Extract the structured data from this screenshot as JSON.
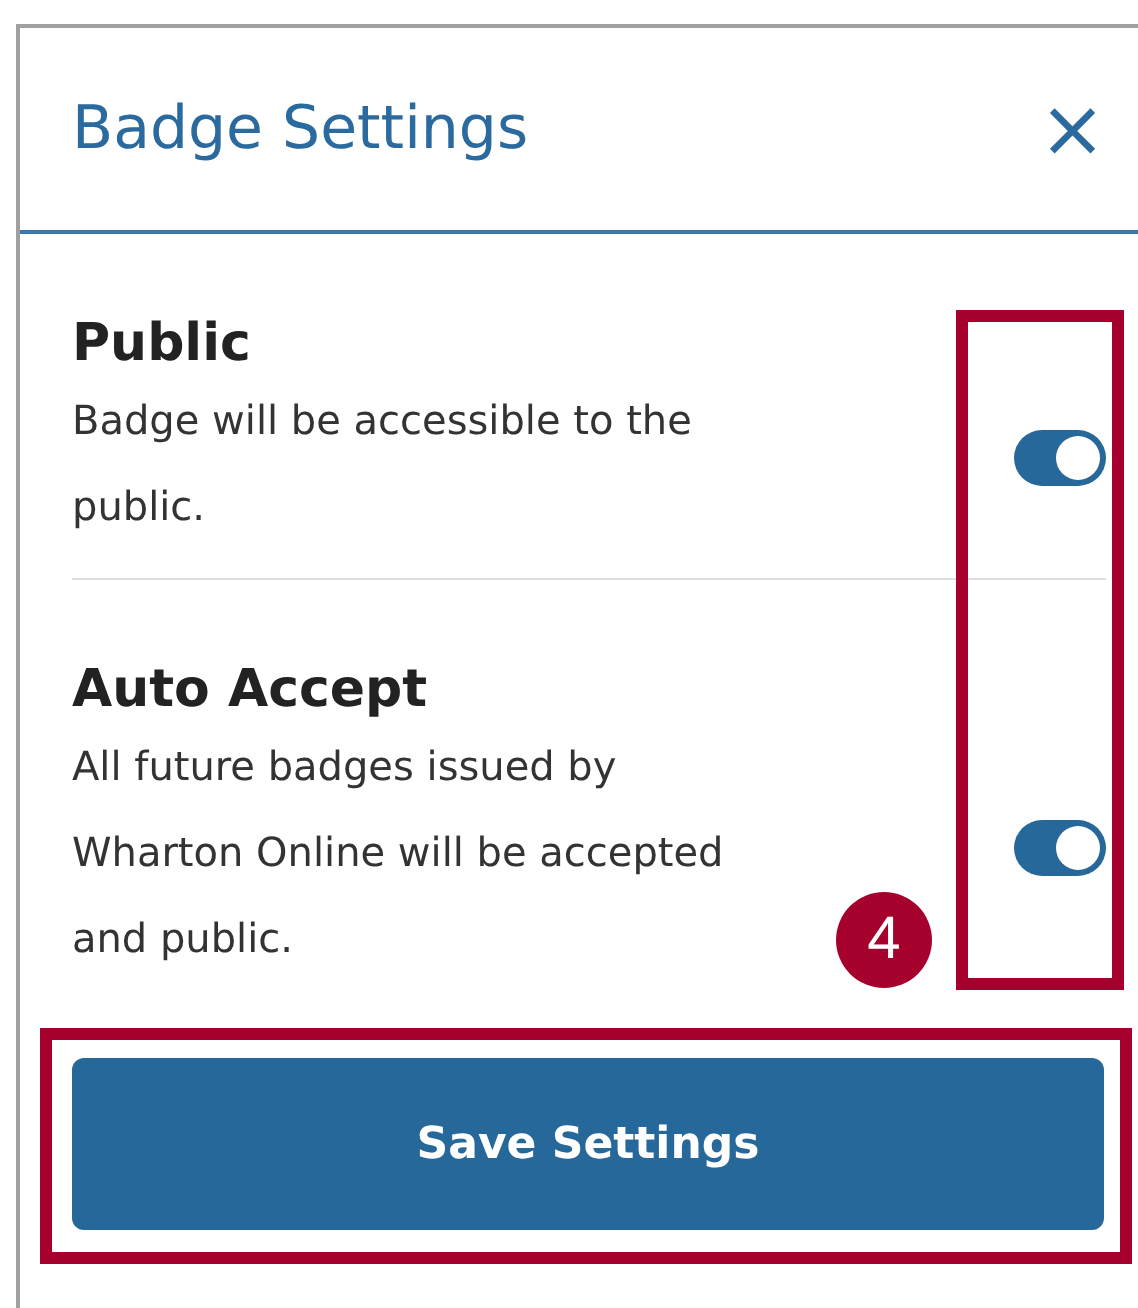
{
  "dialog": {
    "title": "Badge Settings",
    "close_label": "×"
  },
  "settings": [
    {
      "title": "Public",
      "description_lines": [
        "Badge will be accessible to the",
        "public."
      ],
      "on": true
    },
    {
      "title": "Auto Accept",
      "description_lines": [
        "All future badges issued by",
        "Wharton Online will be accepted",
        "and public."
      ],
      "on": true
    }
  ],
  "save_button": "Save Settings",
  "callout": {
    "number": "4"
  }
}
